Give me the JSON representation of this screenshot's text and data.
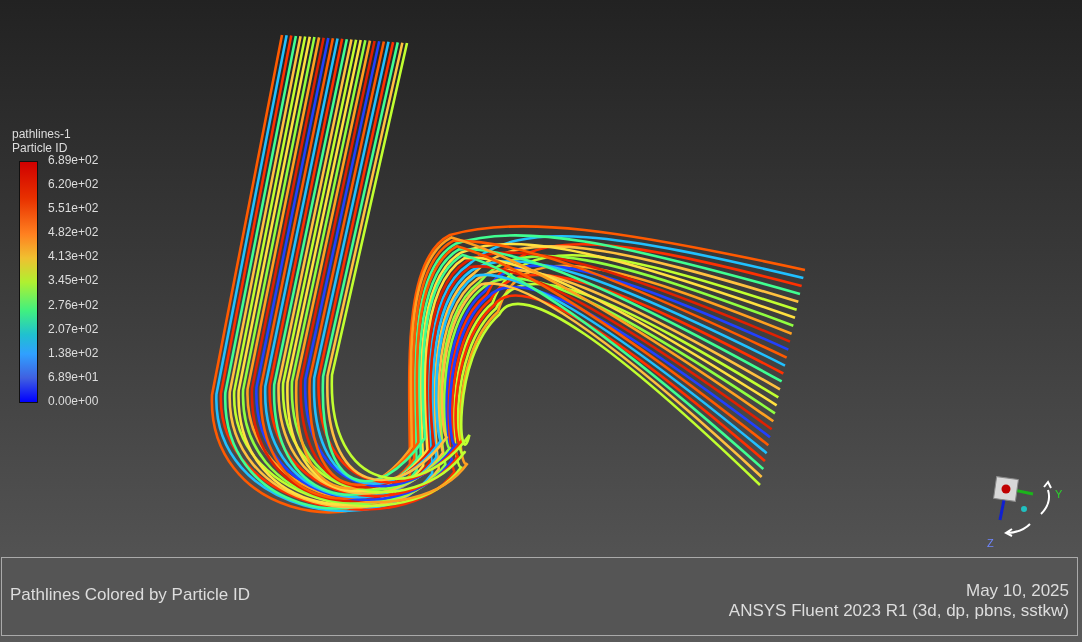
{
  "legend": {
    "title": "pathlines-1",
    "quantity": "Particle ID",
    "ticks": [
      "6.89e+02",
      "6.20e+02",
      "5.51e+02",
      "4.82e+02",
      "4.13e+02",
      "3.45e+02",
      "2.76e+02",
      "2.07e+02",
      "1.38e+02",
      "6.89e+01",
      "0.00e+00"
    ]
  },
  "triad": {
    "axes": [
      {
        "label": "Y"
      },
      {
        "label": "Z"
      }
    ]
  },
  "footer": {
    "title": "Pathlines Colored by Particle ID",
    "date": "May 10, 2025",
    "version": "ANSYS Fluent 2023 R1 (3d, dp, pbns, sstkw)"
  }
}
